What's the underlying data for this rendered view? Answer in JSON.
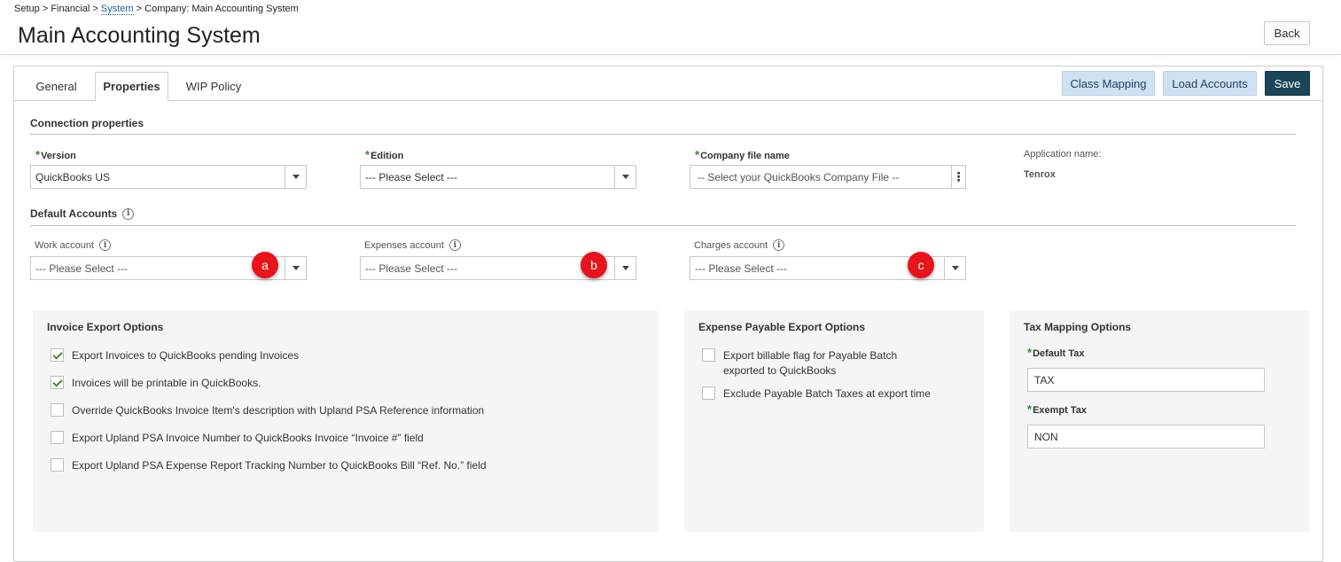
{
  "breadcrumb": {
    "part1": "Setup",
    "sep": ">",
    "part2": "Financial",
    "part3": "System",
    "part4": "Company: Main Accounting System"
  },
  "page": {
    "title": "Main Accounting System",
    "back_label": "Back"
  },
  "tabs": [
    {
      "label": "General",
      "active": false
    },
    {
      "label": "Properties",
      "active": true
    },
    {
      "label": "WIP Policy",
      "active": false
    }
  ],
  "toolbar": {
    "class_mapping_label": "Class Mapping",
    "load_accounts_label": "Load Accounts",
    "save_label": "Save"
  },
  "connection": {
    "title": "Connection properties",
    "version_label": "Version",
    "version_value": "QuickBooks US",
    "edition_label": "Edition",
    "edition_value": "--- Please Select ---",
    "company_file_label": "Company file name",
    "company_file_value": "-- Select your QuickBooks Company File --",
    "app_name_label": "Application name:",
    "app_name_value": "Tenrox",
    "required_mark": "*"
  },
  "default_accounts": {
    "title": "Default Accounts",
    "work_label": "Work account",
    "work_value": "--- Please Select ---",
    "expenses_label": "Expenses account",
    "expenses_value": "--- Please Select ---",
    "charges_label": "Charges account",
    "charges_value": "--- Please Select ---",
    "markers": [
      "a",
      "b",
      "c"
    ]
  },
  "invoice_options": {
    "title": "Invoice Export Options",
    "items": [
      {
        "label": "Export Invoices to QuickBooks pending Invoices",
        "checked": true
      },
      {
        "label": "Invoices will be printable in QuickBooks.",
        "checked": true
      },
      {
        "label": "Override QuickBooks Invoice Item's description with Upland PSA Reference information",
        "checked": false
      },
      {
        "label": "Export Upland PSA Invoice Number to QuickBooks Invoice “Invoice #” field",
        "checked": false
      },
      {
        "label": "Export Upland PSA Expense Report Tracking Number to QuickBooks Bill “Ref. No.” field",
        "checked": false
      }
    ]
  },
  "expense_options": {
    "title": "Expense Payable Export Options",
    "items": [
      {
        "label": "Export billable flag for Payable Batch exported to QuickBooks",
        "checked": false
      },
      {
        "label": "Exclude Payable Batch Taxes at export time",
        "checked": false
      }
    ]
  },
  "tax_options": {
    "title": "Tax Mapping Options",
    "default_tax_label": "Default Tax",
    "default_tax_value": "TAX",
    "exempt_tax_label": "Exempt Tax",
    "exempt_tax_value": "NON"
  },
  "icons": {
    "info": "info-icon",
    "dropdown": "chevron-down-icon",
    "more": "kebab-menu-icon",
    "check": "checkmark-icon"
  },
  "colors": {
    "save_bg": "#1b4458",
    "light_button_bg": "#cfe2f3",
    "marker": "#e8141b",
    "required": "#2e8b2e",
    "check": "#4a8a2a"
  }
}
